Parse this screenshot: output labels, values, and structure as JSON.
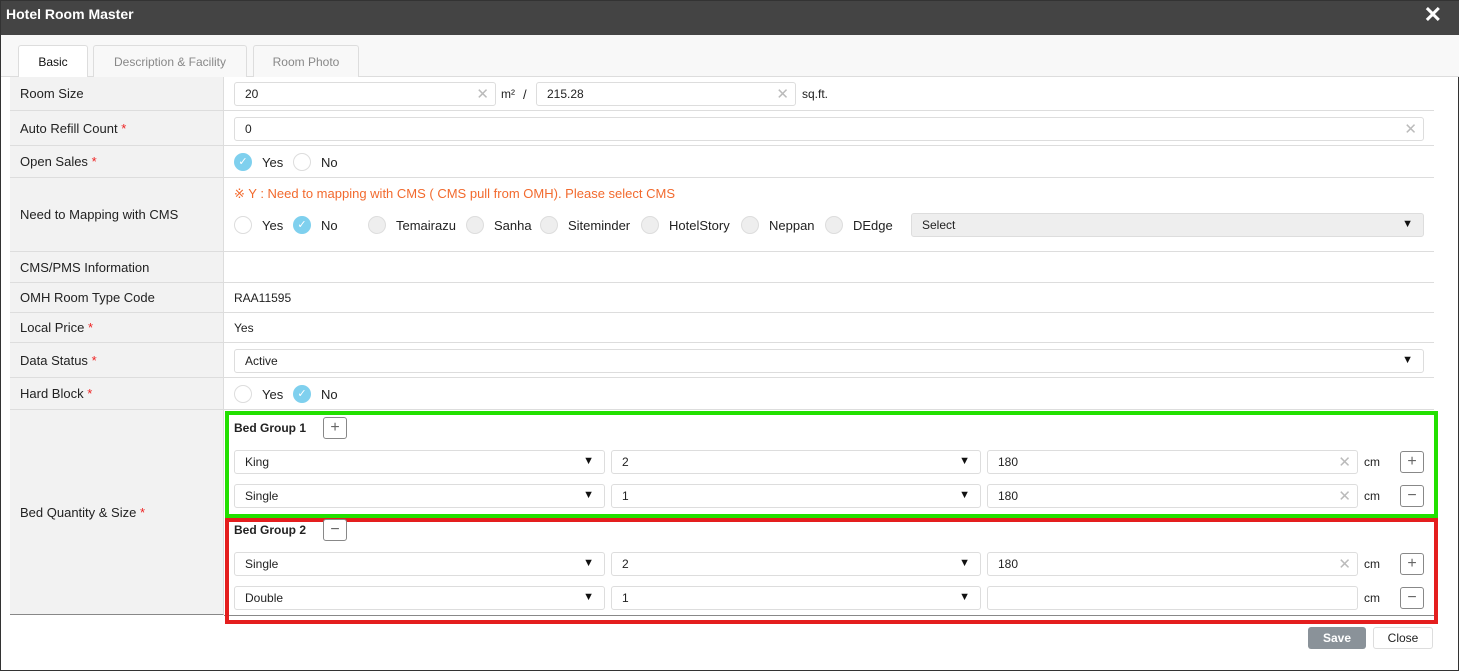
{
  "window": {
    "title": "Hotel Room Master",
    "close": "✕"
  },
  "tabs": [
    "Basic",
    "Description & Facility",
    "Room Photo"
  ],
  "labels": {
    "room_size": "Room Size",
    "auto_refill": "Auto Refill Count",
    "open_sales": "Open Sales",
    "mapping": "Need to Mapping with CMS",
    "cms_info": "CMS/PMS Information",
    "omh_code": "OMH Room Type Code",
    "local_price": "Local Price",
    "data_status": "Data Status",
    "hard_block": "Hard Block",
    "bed": "Bed Quantity & Size",
    "required": "*"
  },
  "room_size": {
    "m2": "20",
    "m2_unit": "m²",
    "sep": "/",
    "sqft": "215.28",
    "sqft_unit": "sq.ft."
  },
  "auto_refill": "0",
  "yes": "Yes",
  "no": "No",
  "mapping_note": "※ Y : Need to mapping with CMS ( CMS pull from OMH). Please select CMS",
  "cms_options": [
    "Temairazu",
    "Sanha",
    "Siteminder",
    "HotelStory",
    "Neppan",
    "DEdge"
  ],
  "cms_select": "Select",
  "omh_code": "RAA11595",
  "local_price": "Yes",
  "data_status": "Active",
  "bed_groups": [
    {
      "title": "Bed Group 1",
      "rows": [
        {
          "type": "King",
          "qty": "2",
          "size": "180"
        },
        {
          "type": "Single",
          "qty": "1",
          "size": "180"
        }
      ]
    },
    {
      "title": "Bed Group 2",
      "rows": [
        {
          "type": "Single",
          "qty": "2",
          "size": "180"
        },
        {
          "type": "Double",
          "qty": "1",
          "size": ""
        }
      ]
    }
  ],
  "unit_cm": "cm",
  "buttons": {
    "save": "Save",
    "close": "Close"
  }
}
